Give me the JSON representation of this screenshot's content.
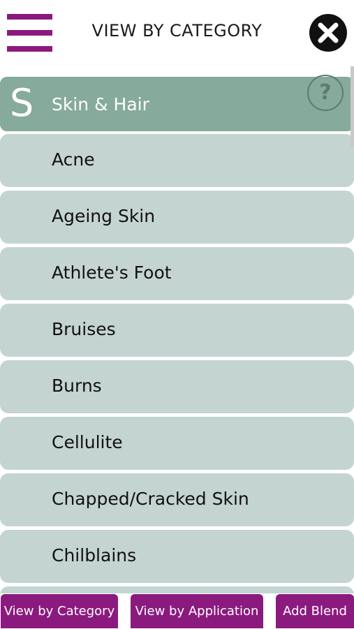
{
  "header": {
    "title": "VIEW BY CATEGORY",
    "menu_icon": "hamburger-menu-icon",
    "close_icon": "close-icon",
    "accent_color": "#8b1a7e"
  },
  "section": {
    "letter": "S",
    "label": "Skin & Hair",
    "color": "#86aa9b",
    "help": "?"
  },
  "items": [
    {
      "label": "Acne"
    },
    {
      "label": "Ageing Skin"
    },
    {
      "label": "Athlete's Foot"
    },
    {
      "label": "Bruises"
    },
    {
      "label": "Burns"
    },
    {
      "label": "Cellulite"
    },
    {
      "label": "Chapped/Cracked Skin"
    },
    {
      "label": "Chilblains"
    }
  ],
  "footer": {
    "tabs": [
      {
        "label": "View by Category"
      },
      {
        "label": "View by Application"
      },
      {
        "label": "Add Blend"
      }
    ]
  }
}
